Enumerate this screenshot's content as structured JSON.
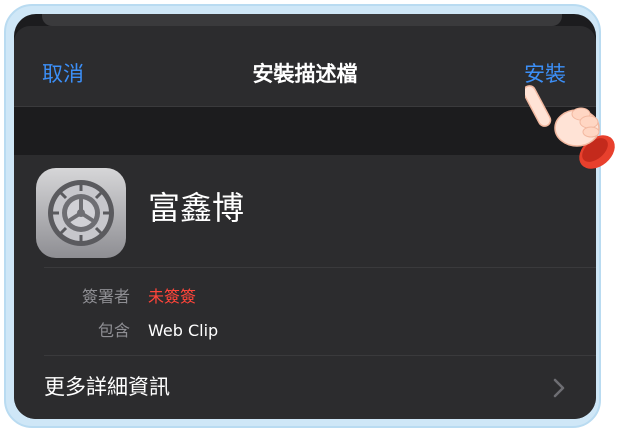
{
  "navbar": {
    "cancel_label": "取消",
    "title": "安裝描述檔",
    "install_label": "安裝"
  },
  "profile": {
    "name": "富鑫博",
    "signer_label": "簽署者",
    "signer_value": "未簽簽",
    "contains_label": "包含",
    "contains_value": "Web Clip",
    "more_label": "更多詳細資訊"
  },
  "colors": {
    "accent": "#3c8ff7",
    "unsigned": "#ff453a",
    "frame": "#cfe7f7"
  },
  "icons": {
    "app": "settings-gear-icon",
    "hand": "pointing-hand-icon",
    "chevron": "chevron-right-icon"
  }
}
